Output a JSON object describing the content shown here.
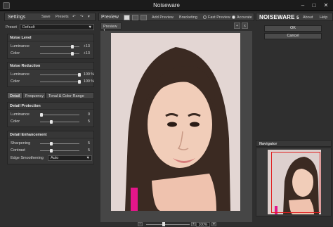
{
  "window": {
    "title": "Noiseware"
  },
  "left_panel": {
    "title": "Settings",
    "save_label": "Save",
    "presets_label": "Presets",
    "preset_label": "Preset",
    "preset_value": "Default",
    "noise_level": {
      "heading": "Noise Level",
      "rows": [
        {
          "label": "Luminance",
          "value": "+13",
          "level": 0.82
        },
        {
          "label": "Color",
          "value": "+13",
          "level": 0.82
        }
      ]
    },
    "noise_reduction": {
      "heading": "Noise Reduction",
      "rows": [
        {
          "label": "Luminance",
          "value": "100",
          "unit": "%",
          "level": 1.0
        },
        {
          "label": "Color",
          "value": "100",
          "unit": "%",
          "level": 1.0
        }
      ]
    },
    "tabs": [
      "Detail",
      "Frequency",
      "Tonal & Color Range"
    ],
    "detail_protection": {
      "heading": "Detail Protection",
      "rows": [
        {
          "label": "Luminance",
          "value": "0",
          "level": 0.0
        },
        {
          "label": "Color",
          "value": "5",
          "level": 0.25
        }
      ]
    },
    "detail_enhancement": {
      "heading": "Detail Enhancement",
      "rows": [
        {
          "label": "Sharpening",
          "value": "5",
          "level": 0.25
        },
        {
          "label": "Contrast",
          "value": "5",
          "level": 0.25
        }
      ],
      "edge_label": "Edge Smoothening",
      "edge_value": "Auto"
    }
  },
  "center_panel": {
    "title": "Preview",
    "add_preview_label": "Add Preview",
    "bracketing_label": "Bracketing",
    "fast_preview_label": "Fast Preview",
    "accurate_label": "Accurate",
    "accurate_selected": true,
    "preview_tab": "Preview 1",
    "zoom_value": "100%",
    "zoom_level": 0.4
  },
  "right_panel": {
    "brand": "NOISEWARE",
    "version": "5",
    "about_label": "About",
    "help_label": "Help",
    "ok_label": "OK",
    "cancel_label": "Cancel",
    "navigator_label": "Navigator"
  },
  "colors": {
    "panel": "#2f2f2f",
    "navigator_frame": "#e02020"
  }
}
